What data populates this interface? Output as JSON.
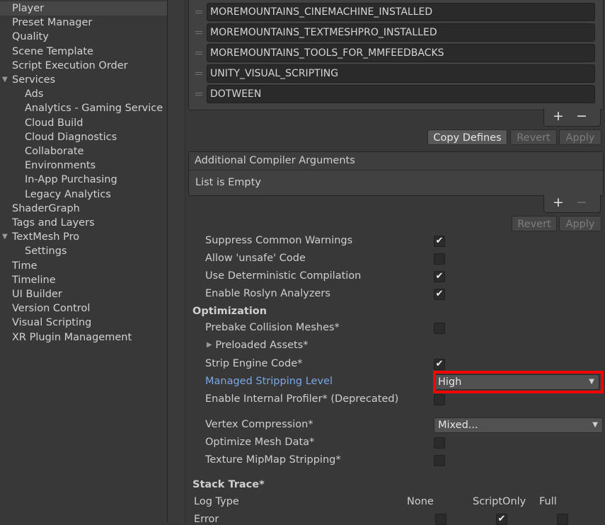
{
  "sidebar": {
    "items": [
      {
        "label": "Player",
        "indent": 1,
        "selected": true
      },
      {
        "label": "Preset Manager",
        "indent": 1
      },
      {
        "label": "Quality",
        "indent": 1
      },
      {
        "label": "Scene Template",
        "indent": 1
      },
      {
        "label": "Script Execution Order",
        "indent": 1
      },
      {
        "label": "Services",
        "indent": 1,
        "foldout": "▼"
      },
      {
        "label": "Ads",
        "indent": 2
      },
      {
        "label": "Analytics - Gaming Service",
        "indent": 2
      },
      {
        "label": "Cloud Build",
        "indent": 2
      },
      {
        "label": "Cloud Diagnostics",
        "indent": 2
      },
      {
        "label": "Collaborate",
        "indent": 2
      },
      {
        "label": "Environments",
        "indent": 2
      },
      {
        "label": "In-App Purchasing",
        "indent": 2
      },
      {
        "label": "Legacy Analytics",
        "indent": 2
      },
      {
        "label": "ShaderGraph",
        "indent": 1
      },
      {
        "label": "Tags and Layers",
        "indent": 1
      },
      {
        "label": "TextMesh Pro",
        "indent": 1,
        "foldout": "▼"
      },
      {
        "label": "Settings",
        "indent": 2
      },
      {
        "label": "Time",
        "indent": 1
      },
      {
        "label": "Timeline",
        "indent": 1
      },
      {
        "label": "UI Builder",
        "indent": 1
      },
      {
        "label": "Version Control",
        "indent": 1
      },
      {
        "label": "Visual Scripting",
        "indent": 1
      },
      {
        "label": "XR Plugin Management",
        "indent": 1
      }
    ]
  },
  "defines": {
    "items": [
      "MOREMOUNTAINS_CINEMACHINE_INSTALLED",
      "MOREMOUNTAINS_TEXTMESHPRO_INSTALLED",
      "MOREMOUNTAINS_TOOLS_FOR_MMFEEDBACKS",
      "UNITY_VISUAL_SCRIPTING",
      "DOTWEEN"
    ],
    "plus": "+",
    "minus": "−",
    "copy_label": "Copy Defines",
    "revert_label": "Revert",
    "apply_label": "Apply"
  },
  "compiler_args": {
    "title": "Additional Compiler Arguments",
    "empty": "List is Empty",
    "plus": "+",
    "minus": "−",
    "revert_label": "Revert",
    "apply_label": "Apply"
  },
  "settings": {
    "suppress_warnings": {
      "label": "Suppress Common Warnings",
      "checked": true
    },
    "allow_unsafe": {
      "label": "Allow 'unsafe' Code",
      "checked": false
    },
    "deterministic": {
      "label": "Use Deterministic Compilation",
      "checked": true
    },
    "roslyn": {
      "label": "Enable Roslyn Analyzers",
      "checked": true
    }
  },
  "optimization": {
    "header": "Optimization",
    "prebake": {
      "label": "Prebake Collision Meshes*",
      "checked": false
    },
    "preloaded": {
      "label": "Preloaded Assets*",
      "foldout": "▶"
    },
    "strip_engine": {
      "label": "Strip Engine Code*",
      "checked": true
    },
    "stripping_level": {
      "label": "Managed Stripping Level",
      "value": "High"
    },
    "internal_profiler": {
      "label": "Enable Internal Profiler* (Deprecated)",
      "checked": false
    },
    "vertex_compression": {
      "label": "Vertex Compression*",
      "value": "Mixed..."
    },
    "optimize_mesh": {
      "label": "Optimize Mesh Data*",
      "checked": false
    },
    "mipmap_stripping": {
      "label": "Texture MipMap Stripping*",
      "checked": false
    }
  },
  "stack_trace": {
    "header": "Stack Trace*",
    "log_type": "Log Type",
    "columns": [
      "None",
      "ScriptOnly",
      "Full"
    ],
    "row_error": "Error"
  },
  "icons": {
    "check": "✔",
    "dropdown": "▼"
  },
  "colors": {
    "highlight_border": "#ff0000",
    "highlight_label": "#7aa7e6"
  }
}
